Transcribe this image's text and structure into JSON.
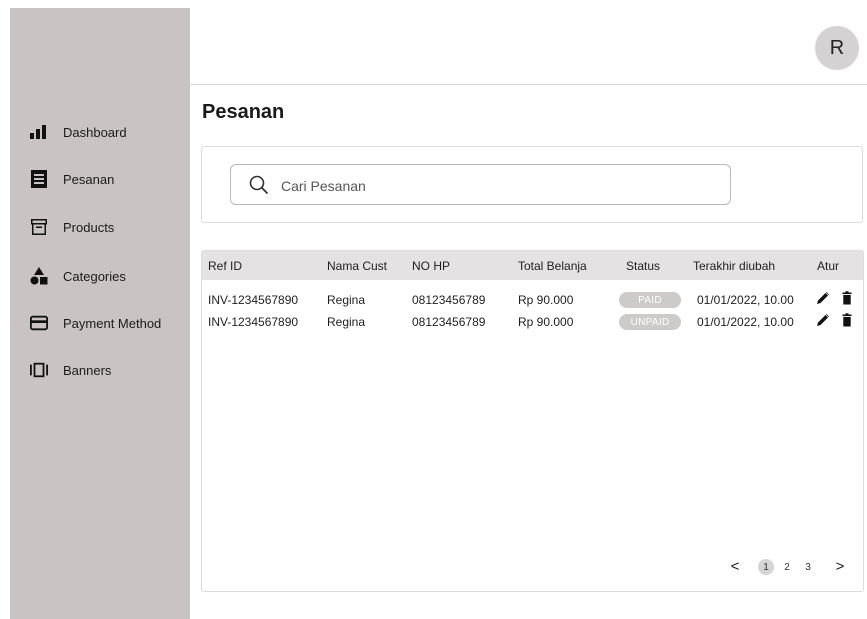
{
  "sidebar": {
    "items": [
      {
        "label": "Dashboard",
        "icon": "bar-chart-icon"
      },
      {
        "label": "Pesanan",
        "icon": "receipt-icon"
      },
      {
        "label": "Products",
        "icon": "archive-box-icon"
      },
      {
        "label": "Categories",
        "icon": "category-shapes-icon"
      },
      {
        "label": "Payment Method",
        "icon": "credit-card-icon"
      },
      {
        "label": "Banners",
        "icon": "carousel-icon"
      }
    ]
  },
  "header": {
    "avatar_initial": "R"
  },
  "page": {
    "title": "Pesanan"
  },
  "search": {
    "placeholder": "Cari Pesanan",
    "value": ""
  },
  "table": {
    "columns": [
      "Ref ID",
      "Nama Cust",
      "NO HP",
      "Total Belanja",
      "Status",
      "Terakhir diubah",
      "Atur"
    ],
    "rows": [
      {
        "ref_id": "INV-1234567890",
        "name": "Regina",
        "phone": "08123456789",
        "total": "Rp 90.000",
        "status": "PAID",
        "updated": "01/01/2022, 10.00"
      },
      {
        "ref_id": "INV-1234567890",
        "name": "Regina",
        "phone": "08123456789",
        "total": "Rp 90.000",
        "status": "UNPAID",
        "updated": "01/01/2022, 10.00"
      }
    ]
  },
  "pagination": {
    "prev": "<",
    "pages": [
      "1",
      "2",
      "3"
    ],
    "current": "1",
    "next": ">"
  },
  "colors": {
    "sidebar_bg": "#c9c4c3",
    "badge_bg": "#cdcaca",
    "table_header_bg": "#e4e2e2"
  }
}
